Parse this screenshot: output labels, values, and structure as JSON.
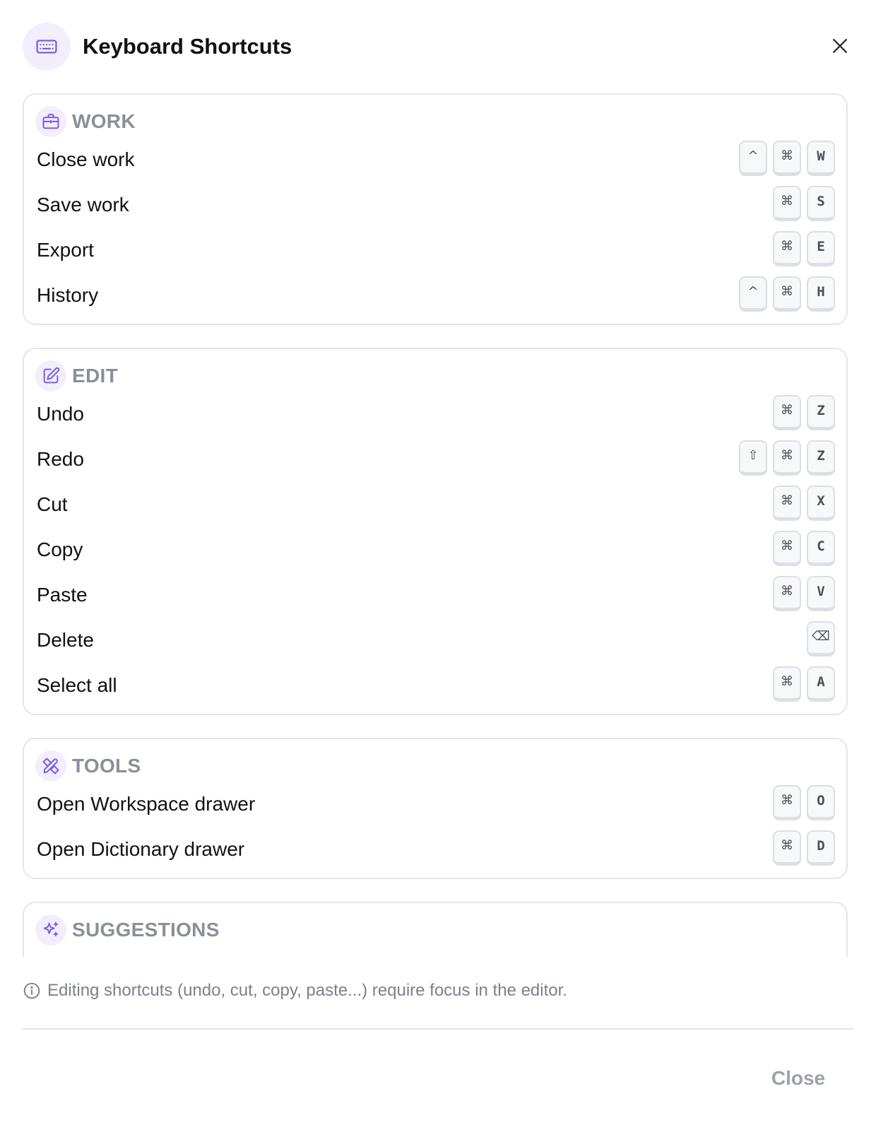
{
  "dialog": {
    "title": "Keyboard Shortcuts",
    "header_icon": "keyboard-icon",
    "close_icon": "close-icon"
  },
  "sections": [
    {
      "title": "WORK",
      "icon": "briefcase-icon",
      "rows": [
        {
          "label": "Close work",
          "keys": [
            "^",
            "⌘",
            "W"
          ]
        },
        {
          "label": "Save work",
          "keys": [
            "⌘",
            "S"
          ]
        },
        {
          "label": "Export",
          "keys": [
            "⌘",
            "E"
          ]
        },
        {
          "label": "History",
          "keys": [
            "^",
            "⌘",
            "H"
          ]
        }
      ]
    },
    {
      "title": "EDIT",
      "icon": "pencil-square-icon",
      "rows": [
        {
          "label": "Undo",
          "keys": [
            "⌘",
            "Z"
          ]
        },
        {
          "label": "Redo",
          "keys": [
            "⇧",
            "⌘",
            "Z"
          ]
        },
        {
          "label": "Cut",
          "keys": [
            "⌘",
            "X"
          ]
        },
        {
          "label": "Copy",
          "keys": [
            "⌘",
            "C"
          ]
        },
        {
          "label": "Paste",
          "keys": [
            "⌘",
            "V"
          ]
        },
        {
          "label": "Delete",
          "keys": [
            "⌫"
          ]
        },
        {
          "label": "Select all",
          "keys": [
            "⌘",
            "A"
          ]
        }
      ]
    },
    {
      "title": "TOOLS",
      "icon": "tools-icon",
      "rows": [
        {
          "label": "Open Workspace drawer",
          "keys": [
            "⌘",
            "O"
          ]
        },
        {
          "label": "Open Dictionary drawer",
          "keys": [
            "⌘",
            "D"
          ]
        }
      ]
    },
    {
      "title": "SUGGESTIONS",
      "icon": "sparkles-icon",
      "rows": []
    }
  ],
  "footer": {
    "note": "Editing shortcuts (undo, cut, copy, paste...) require focus in the editor.",
    "info_icon": "info-icon",
    "close_label": "Close"
  },
  "colors": {
    "accent": "#7c5ce6",
    "accent_bg": "#f2eefd",
    "muted": "#8a8f98",
    "border": "#e4e6ea"
  }
}
